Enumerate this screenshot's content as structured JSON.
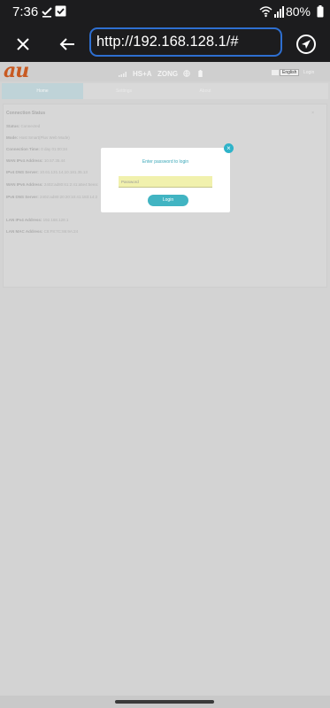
{
  "status_bar": {
    "time": "7:36",
    "battery": "80%",
    "icons": [
      "download-done-icon",
      "checkbox-icon",
      "wifi-icon",
      "signal-icon",
      "battery-icon"
    ]
  },
  "browser": {
    "url": "http://192.168.128.1/#",
    "icons": [
      "close-icon",
      "back-arrow-icon",
      "navigate-icon"
    ]
  },
  "router": {
    "logo": "au",
    "network_type": "HS+A",
    "operator": "ZONG",
    "language": "English",
    "login_link": "Login",
    "nav_tabs": [
      "Home",
      "Settings",
      "About"
    ],
    "panel_title": "Connection Status",
    "rows": [
      {
        "label": "Status:",
        "value": "Connected"
      },
      {
        "label": "Mode:",
        "value": "Host Smart(Plus Web Mode)"
      },
      {
        "label": "Connection Time:",
        "value": "0 day 01:00:34"
      },
      {
        "label": "WAN IPv4 Address:",
        "value": "10.57.35.44"
      },
      {
        "label": "IPv4 DNS Server:",
        "value": "10.61.131.14,10.181.35.13"
      },
      {
        "label": "WAN IPv6 Address:",
        "value": "2402:ad80:61:2:41:a5e4:5eea:"
      },
      {
        "label": "IPv6 DNS Server:",
        "value": "2402:ad80:20:20:10:41:183:14:2"
      },
      {
        "label": "LAN IPv4 Address:",
        "value": "192.168.128.1"
      },
      {
        "label": "LAN MAC Address:",
        "value": "C8:F8:7C:86:9A:24"
      }
    ]
  },
  "modal": {
    "title": "Enter password to login",
    "password_placeholder": "Password",
    "login_button": "Login"
  },
  "colors": {
    "url_border": "#2e6fd1",
    "accent": "#41b4c2",
    "logo": "#c85a22",
    "input_bg": "#f1f1ad"
  }
}
